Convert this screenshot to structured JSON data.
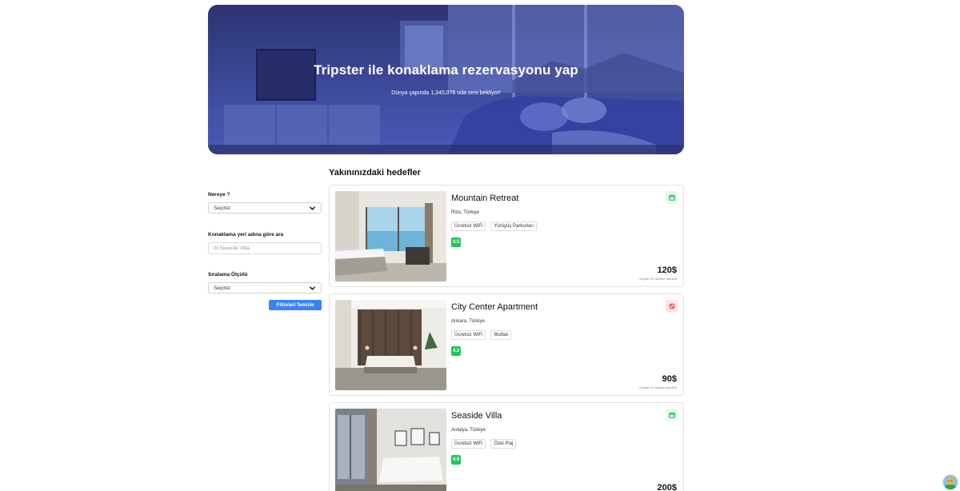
{
  "hero": {
    "title": "Tripster ile konaklama rezervasyonu yap",
    "subtitle": "Dünya çapında 1,340,076 oda seni bekliyor!"
  },
  "section_title": "Yakınınızdaki hedefler",
  "filters": {
    "destination_label": "Nereye ?",
    "destination_value": "Seçiniz",
    "search_label": "Konaklama yeri adına göre ara",
    "search_placeholder": "ör.Seaside Villa",
    "sort_label": "Sıralama Ölçütü",
    "sort_value": "Seçiniz",
    "clear_button": "Filtreleri Temizle"
  },
  "listings": [
    {
      "name": "Mountain Retreat",
      "location": "Rize, Türkiye",
      "tags": [
        "Ücretsiz WiFi",
        "Yürüyüş Parkurları"
      ],
      "rating": "4.5",
      "price": "120$",
      "price_note": "vergiler ve ücretler dahildir",
      "status_icon": "calendar-check-icon",
      "status_color": "#16a34a"
    },
    {
      "name": "City Center Apartment",
      "location": "Ankara, Türkiye",
      "tags": [
        "Ücretsiz WiFi",
        "Mutfak"
      ],
      "rating": "4.2",
      "price": "90$",
      "price_note": "vergiler ve ücretler dahildir",
      "status_icon": "unavailable-icon",
      "status_color": "#dc2626"
    },
    {
      "name": "Seaside Villa",
      "location": "Antalya, Türkiye",
      "tags": [
        "Ücretsiz WiFi",
        "Özel Plaj"
      ],
      "rating": "4.9",
      "price": "200$",
      "price_note": "vergiler ve ücretler dahildir",
      "status_icon": "calendar-check-icon",
      "status_color": "#16a34a"
    }
  ],
  "colors": {
    "primary": "#3b82f6",
    "rating": "#22c55e",
    "hero": "#3a4694"
  }
}
